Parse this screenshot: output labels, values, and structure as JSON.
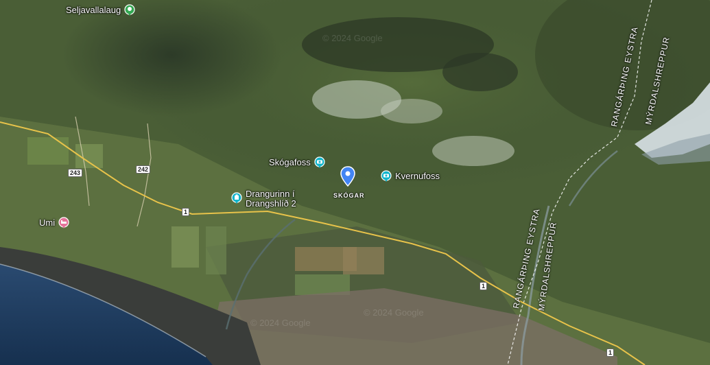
{
  "map": {
    "pois": [
      {
        "id": "seljavallalaug",
        "label": "Seljavallalaug",
        "type": "park",
        "color": "#34a853"
      },
      {
        "id": "skogafoss",
        "label": "Skógafoss",
        "type": "camera",
        "color": "#12b5cb"
      },
      {
        "id": "kvernufoss",
        "label": "Kvernufoss",
        "type": "camera",
        "color": "#12b5cb"
      },
      {
        "id": "drangurinn",
        "label1": "Drangurinn í",
        "label2": "Drangshlíð 2",
        "type": "landmark",
        "color": "#12b5cb"
      },
      {
        "id": "umi",
        "label": "Umi",
        "type": "hotel",
        "color": "#e57399"
      }
    ],
    "dropped_pin": {
      "color": "#4285f4",
      "icon": "location-pin-icon"
    },
    "town_label": "SKÓGAR",
    "road_shields": [
      "243",
      "242",
      "1",
      "1",
      "1"
    ],
    "regions": {
      "rangarthing_top": "RANGÁRÞING EYSTRA",
      "myrdal_top": "MÝRDALSHREPPUR",
      "rangarthing_bottom": "RANGÁRÞING EYSTRA",
      "myrdal_bottom": "MÝRDALSHREPPUR"
    },
    "watermarks": [
      "© 2024 Google",
      "© 2024 Google",
      "© 2024 Google"
    ],
    "colors": {
      "road": "#e8c34a",
      "ocean": "#1c3553",
      "water": "#2a4a5c"
    }
  }
}
